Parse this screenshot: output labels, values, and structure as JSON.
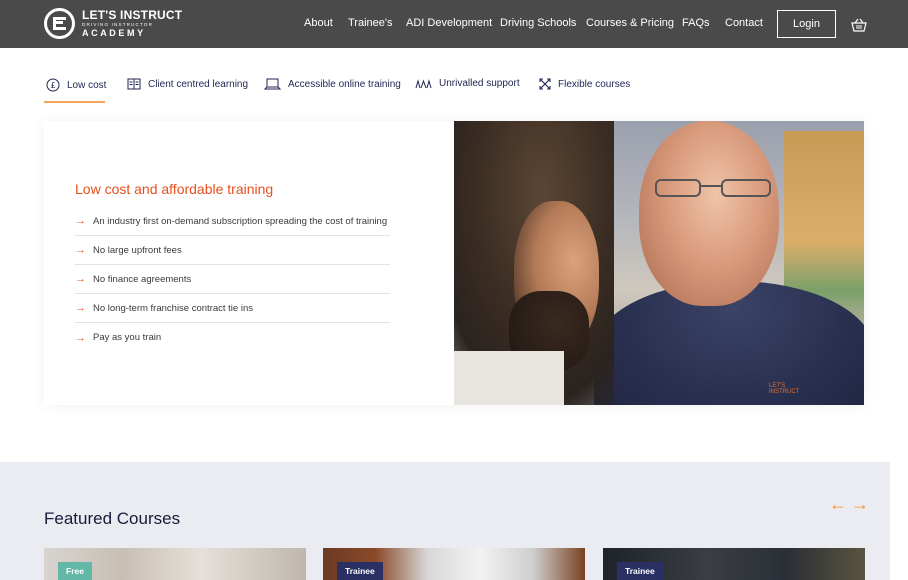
{
  "brand": {
    "line1": "LET'S INSTRUCT",
    "line2": "DRIVING INSTRUCTOR",
    "line3": "ACADEMY"
  },
  "nav": {
    "items": [
      "About",
      "Trainee's",
      "ADI Development",
      "Driving Schools",
      "Courses & Pricing",
      "FAQs",
      "Contact"
    ],
    "login_label": "Login",
    "basket_icon": "basket-icon"
  },
  "tabs": [
    {
      "label": "Low cost",
      "icon": "pound-icon",
      "active": true
    },
    {
      "label": "Client centred learning",
      "icon": "book-icon",
      "active": false
    },
    {
      "label": "Accessible online training",
      "icon": "laptop-icon",
      "active": false
    },
    {
      "label": "Unrivalled support",
      "icon": "people-icon",
      "active": false
    },
    {
      "label": "Flexible courses",
      "icon": "expand-icon",
      "active": false
    }
  ],
  "feature": {
    "title": "Low cost and affordable training",
    "points": [
      "An industry first on-demand subscription spreading the cost of training",
      "No large upfront fees",
      "No finance agreements",
      "No long-term franchise contract tie ins",
      "Pay as you train"
    ],
    "photo_patch": "LET'S INSTRUCT"
  },
  "featured": {
    "title": "Featured Courses",
    "prev_icon": "arrow-left-icon",
    "next_icon": "arrow-right-icon",
    "courses": [
      {
        "badge": "Free"
      },
      {
        "badge": "Trainee"
      },
      {
        "badge": "Trainee"
      }
    ]
  },
  "colors": {
    "header_bg": "#4a4a4a",
    "accent_orange": "#e8501e",
    "arrow_orange": "#f29220",
    "tab_text": "#1f2452",
    "badge_free": "#62b7a6",
    "badge_trainee": "#2a2f64",
    "featured_bg": "#ebebf2"
  }
}
